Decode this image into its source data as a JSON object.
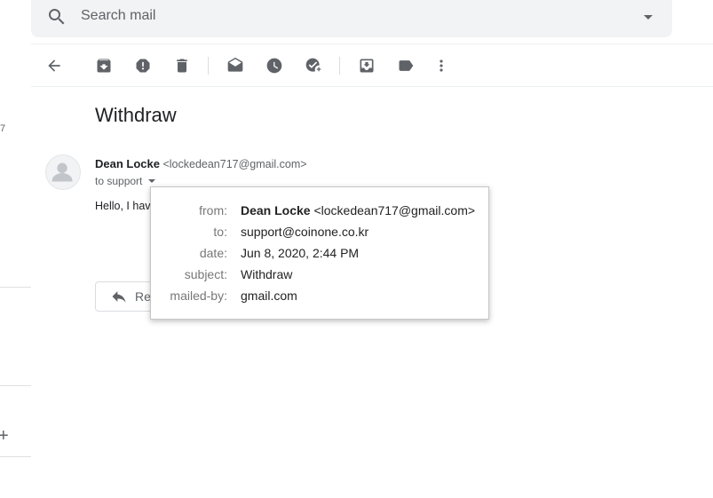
{
  "search": {
    "placeholder": "Search mail"
  },
  "left_nav": {
    "count_fragment": "7",
    "plus_symbol": "+"
  },
  "toolbar": {
    "buttons": [
      {
        "icon": "back-arrow-icon"
      },
      {
        "icon": "archive-icon"
      },
      {
        "icon": "report-spam-icon"
      },
      {
        "icon": "delete-icon"
      },
      {
        "icon": "mark-unread-icon"
      },
      {
        "icon": "snooze-icon"
      },
      {
        "icon": "add-to-tasks-icon"
      },
      {
        "icon": "move-to-icon"
      },
      {
        "icon": "label-icon"
      },
      {
        "icon": "more-vert-icon"
      }
    ]
  },
  "email": {
    "subject": "Withdraw",
    "sender_name": "Dean Locke",
    "sender_email": "<lockedean717@gmail.com>",
    "to_line": "to support",
    "body_preview": "Hello, I hav",
    "reply_label": "Re"
  },
  "details": {
    "from_label": "from:",
    "from_name": "Dean Locke",
    "from_email": "<lockedean717@gmail.com>",
    "to_label": "to:",
    "to_value": "support@coinone.co.kr",
    "date_label": "date:",
    "date_value": "Jun 8, 2020, 2:44 PM",
    "subject_label": "subject:",
    "subject_value": "Withdraw",
    "mailedby_label": "mailed-by:",
    "mailedby_value": "gmail.com"
  },
  "colors": {
    "icon": "#5f6368",
    "search_bg": "#f1f3f4",
    "text": "#202124"
  }
}
